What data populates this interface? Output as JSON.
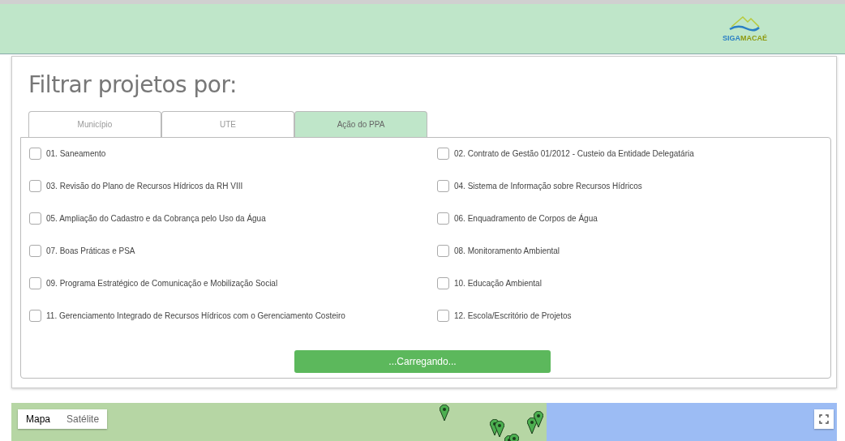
{
  "header": {
    "logo": {
      "word_1": "SIGA",
      "word_2": "MACAÉ"
    }
  },
  "filter": {
    "title": "Filtrar projetos por:",
    "tabs": [
      {
        "label": "Município",
        "selected": false
      },
      {
        "label": "UTE",
        "selected": false
      },
      {
        "label": "Ação do PPA",
        "selected": true
      }
    ],
    "options": [
      {
        "label": "01. Saneamento",
        "checked": false
      },
      {
        "label": "02. Contrato de Gestão 01/2012 - Custeio da Entidade Delegatária",
        "checked": false
      },
      {
        "label": "03. Revisão do Plano de Recursos Hídricos da RH VIII",
        "checked": false
      },
      {
        "label": "04. Sistema de Informação sobre Recursos Hídricos",
        "checked": false
      },
      {
        "label": "05. Ampliação do Cadastro e da Cobrança pelo Uso da Água",
        "checked": false
      },
      {
        "label": "06. Enquadramento de Corpos de Água",
        "checked": false
      },
      {
        "label": "07. Boas Práticas e PSA",
        "checked": false
      },
      {
        "label": "08. Monitoramento Ambiental",
        "checked": false
      },
      {
        "label": "09. Programa Estratégico de Comunicação e Mobilização Social",
        "checked": false
      },
      {
        "label": "10. Educação Ambiental",
        "checked": false
      },
      {
        "label": "11. Gerenciamento Integrado de Recursos Hídricos com o Gerenciamento Costeiro",
        "checked": false
      },
      {
        "label": "12. Escola/Escritório de Projetos",
        "checked": false
      }
    ],
    "button": "...Carregando..."
  },
  "map": {
    "types": [
      {
        "label": "Mapa",
        "selected": true
      },
      {
        "label": "Satélite",
        "selected": false
      }
    ]
  }
}
